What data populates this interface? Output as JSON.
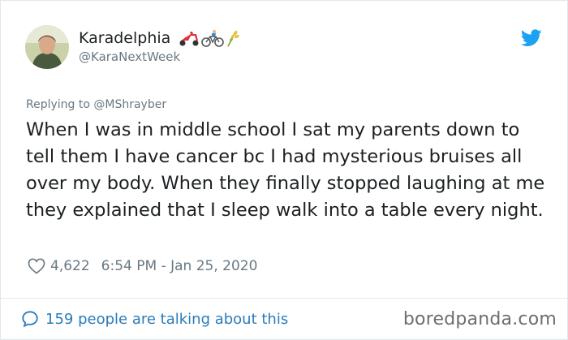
{
  "tweet": {
    "author": {
      "name": "Karadelphia",
      "handle": "@KaraNextWeek",
      "emojis": [
        "scooter-icon",
        "bicycle-icon",
        "wheat-icon"
      ]
    },
    "replying_to": "Replying to @MShrayber",
    "text": "When I was in middle school I sat my parents down to tell them I have cancer bc I had mysterious bruises all over my body. When they finally stopped laughing at me they explained that I sleep walk into a table every night.",
    "likes": "4,622",
    "timestamp": "6:54 PM - Jan 25, 2020",
    "talking": "159 people are talking about this"
  },
  "watermark": "boredpanda.com",
  "colors": {
    "twitter_blue": "#1da1f2",
    "link_blue": "#2b7bb9",
    "muted_text": "#697882",
    "body_text": "#1c2022",
    "border": "#e1e8ed"
  }
}
